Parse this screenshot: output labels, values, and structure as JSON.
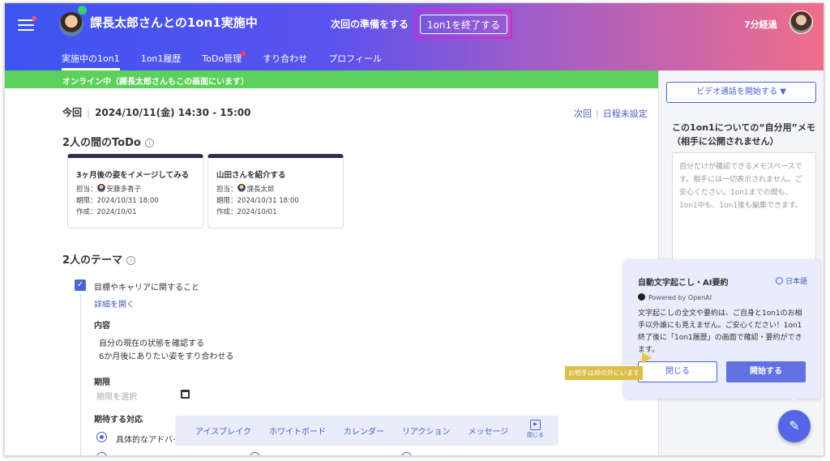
{
  "header": {
    "title": "課長太郎さんとの1on1実施中",
    "prepare_label": "次回の準備をする",
    "end_button": "1on1を終了する",
    "elapsed": "7分経過"
  },
  "tabs": [
    {
      "label": "実施中の1on1"
    },
    {
      "label": "1on1履歴"
    },
    {
      "label": "ToDo管理"
    },
    {
      "label": "すり合わせ"
    },
    {
      "label": "プロフィール"
    }
  ],
  "status_bar": "オンライン中（課長太郎さんもこの画面にいます）",
  "schedule": {
    "label": "今回",
    "datetime": "2024/10/11(金) 14:30 - 15:00",
    "next_label": "次回",
    "unset_label": "日程未設定"
  },
  "todo": {
    "heading": "2人の間のToDo",
    "info_icon": "i",
    "cards": [
      {
        "title": "3ヶ月後の姿をイメージしてみる",
        "assignee_label": "担当：",
        "assignee": "安藤多香子",
        "due": "期限：2024/10/31 18:00",
        "created": "作成：2024/10/01"
      },
      {
        "title": "山田さんを紹介する",
        "assignee_label": "担当：",
        "assignee": "課長太郎",
        "due": "期限：2024/10/31 18:00",
        "created": "作成：2024/10/01"
      }
    ]
  },
  "theme": {
    "heading": "2人のテーマ",
    "item_label": "目標やキャリアに関すること",
    "details_link": "詳細を開く",
    "content_label": "内容",
    "content_lines": [
      "自分の現在の状態を確認する",
      "6か月後にありたい姿をすり合わせる"
    ],
    "deadline_label": "期限",
    "deadline_placeholder": "期限を選択",
    "expectation_label": "期待する対応",
    "option_1": "具体的なアドバイ"
  },
  "toolbar": {
    "items": [
      "アイスブレイク",
      "ホワイトボード",
      "カレンダー",
      "リアクション",
      "メッセージ"
    ],
    "close_label": "閉じる"
  },
  "sidebar": {
    "video_button": "ビデオ通話を開始する ▼",
    "memo_title_1": "この1on1についての“自分用”メモ",
    "memo_title_2": "（相手に公開されません）",
    "memo_placeholder": "自分だけが確認できるメモスペースです。相手には一切表示されません。ご安心ください。1on1までの間も、1on1中も、1on1後も編集できます。"
  },
  "transcription": {
    "title": "自動文字起こし・AI要約",
    "language": "日本語",
    "powered_by": "Powered by OpenAI",
    "description": "文字起こしの全文や要約は、ご自身と1on1のお相手以外誰にも見えません。ご安心ください！1on1終了後に「1on1履歴」の画面で確認・要約ができます。",
    "close_button": "閉じる",
    "start_button": "開始する",
    "outside_notice": "お相手は枠の外にいます"
  },
  "colors": {
    "brand_blue": "#4a63d8",
    "online_green": "#5bd05b",
    "highlight": "#e51fd6"
  }
}
